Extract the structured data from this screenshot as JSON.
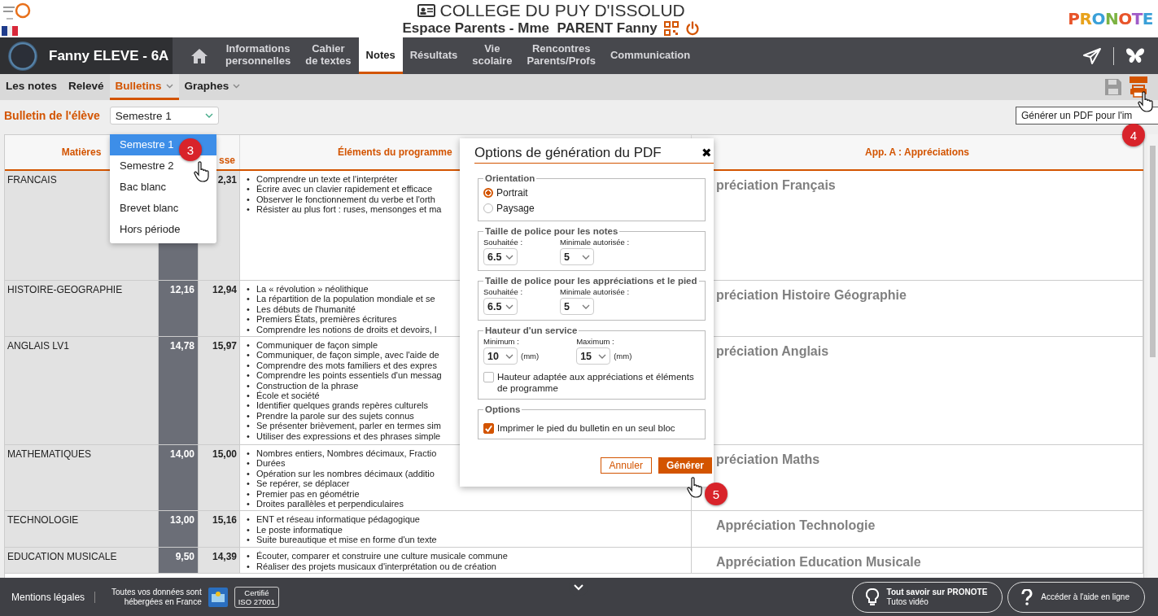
{
  "header": {
    "title": "COLLEGE DU PUY D'ISSOLUD",
    "subtitle": "Espace Parents - Mme  PARENT Fanny",
    "brand": "PRONOTE"
  },
  "nav": {
    "student": "Fanny ELEVE - 6A",
    "tabs": [
      {
        "label": "Informations\npersonnelles",
        "selected": false
      },
      {
        "label": "Cahier\nde textes",
        "selected": false
      },
      {
        "label": "Notes",
        "selected": true
      },
      {
        "label": "Résultats",
        "selected": false
      },
      {
        "label": "Vie\nscolaire",
        "selected": false
      },
      {
        "label": "Rencontres\nParents/Profs",
        "selected": false
      },
      {
        "label": "Communication",
        "selected": false
      }
    ]
  },
  "subnav": {
    "tabs": [
      {
        "label": "Les notes",
        "selected": false,
        "dropdown": false
      },
      {
        "label": "Relevé",
        "selected": false,
        "dropdown": false
      },
      {
        "label": "Bulletins",
        "selected": true,
        "dropdown": true
      },
      {
        "label": "Graphes",
        "selected": false,
        "dropdown": true
      }
    ]
  },
  "filter": {
    "label": "Bulletin de l'élève",
    "value": "Semestre 1"
  },
  "dropdown": {
    "options": [
      {
        "label": "Semestre 1",
        "selected": true
      },
      {
        "label": "Semestre 2",
        "selected": false
      },
      {
        "label": "Bac blanc",
        "selected": false
      },
      {
        "label": "Brevet blanc",
        "selected": false
      },
      {
        "label": "Hors période",
        "selected": false
      }
    ]
  },
  "tooltip": "Générer un PDF pour l'im",
  "steps": [
    "3",
    "4",
    "5"
  ],
  "table": {
    "bullet": "•",
    "headers": {
      "subjects": "Matières",
      "column_3": "sse",
      "program": "Éléments du programme",
      "appreciations": "App. A : Appréciations"
    },
    "rows": [
      {
        "subject": "FRANCAIS",
        "class_average": "2,31",
        "program": [
          "Comprendre un texte et l'interpréter",
          "Écrire avec un clavier rapidement et efficace",
          "Observer le fonctionnement du verbe et l'orth",
          "Résister au plus fort : ruses, mensonges et ma"
        ],
        "appreciation": "préciation Français"
      },
      {
        "subject": "HISTOIRE-GEOGRAPHIE",
        "student_average": "12,16",
        "class_average": "12,94",
        "program": [
          "La « révolution » néolithique",
          "La répartition de la population mondiale et se",
          "Les débuts de l'humanité",
          "Premiers États, premières écritures",
          "Comprendre les notions de droits et devoirs, l"
        ],
        "appreciation": "préciation Histoire Géographie"
      },
      {
        "subject": "ANGLAIS LV1",
        "student_average": "14,78",
        "class_average": "15,97",
        "program": [
          "Communiquer de façon simple",
          "Communiquer, de façon simple, avec l'aide de",
          "Comprendre des mots familiers et des expres",
          "Comprendre les points essentiels d'un messag",
          "Construction de la phrase",
          "École et société",
          "Identifier quelques grands repères culturels",
          "Prendre la parole sur des sujets connus",
          "Se présenter brièvement, parler en termes sim",
          "Utiliser des expressions et des phrases simple"
        ],
        "appreciation": "préciation Anglais"
      },
      {
        "subject": "MATHEMATIQUES",
        "student_average": "14,00",
        "class_average": "15,00",
        "program": [
          "Nombres entiers, Nombres décimaux, Fractio",
          "Durées",
          "Opération sur les nombres décimaux (additio",
          "Se repérer, se déplacer",
          "Premier pas en géométrie",
          "Droites parallèles et perpendiculaires"
        ],
        "appreciation": "préciation Maths"
      },
      {
        "subject": "TECHNOLOGIE",
        "student_average": "13,00",
        "class_average": "15,16",
        "program": [
          "ENT et réseau informatique pédagogique",
          "Le poste informatique",
          "Suite bureautique et mise en forme d'un texte"
        ],
        "appreciation": "Appréciation Technologie"
      },
      {
        "subject": "EDUCATION MUSICALE",
        "student_average": "9,50",
        "class_average": "14,39",
        "program": [
          "Écouter, comparer et construire une culture musicale commune",
          "Réaliser des projets musicaux d'interprétation ou de création"
        ],
        "appreciation": "Appréciation Education Musicale"
      }
    ]
  },
  "dialog": {
    "title": "Options de génération du PDF",
    "close": "✖",
    "orientation": {
      "legend": "Orientation",
      "options": [
        {
          "label": "Portrait",
          "selected": true
        },
        {
          "label": "Paysage",
          "selected": false
        }
      ]
    },
    "font_groups": [
      {
        "legend": "Taille de police pour les notes",
        "fields": [
          {
            "label": "Souhaitée :",
            "value": "6.5"
          },
          {
            "label": "Minimale autorisée :",
            "value": "5"
          }
        ]
      },
      {
        "legend": "Taille de police pour les appréciations et le pied",
        "fields": [
          {
            "label": "Souhaitée :",
            "value": "6.5"
          },
          {
            "label": "Minimale autorisée :",
            "value": "5"
          }
        ]
      }
    ],
    "height": {
      "legend": "Hauteur d'un service",
      "fields": [
        {
          "label": "Minimum :",
          "value": "10",
          "unit": "(mm)"
        },
        {
          "label": "Maximum :",
          "value": "15",
          "unit": "(mm)"
        }
      ],
      "adaptive": {
        "label": "Hauteur adaptée aux appréciations et éléments de programme",
        "checked": false
      }
    },
    "options": {
      "legend": "Options",
      "item": {
        "label": "Imprimer le pied du bulletin en un seul bloc",
        "checked": true
      }
    },
    "cancel": "Annuler",
    "submit": "Générer"
  },
  "footer": {
    "legal": "Mentions légales",
    "hosting": "Toutes vos données sont\nhébergées en France",
    "cert": "Certifié\nISO 27001",
    "tutorial_title": "Tout savoir sur PRONOTE",
    "tutorial_sub": "Tutos vidéo",
    "help": "Accéder à l'aide en ligne"
  }
}
